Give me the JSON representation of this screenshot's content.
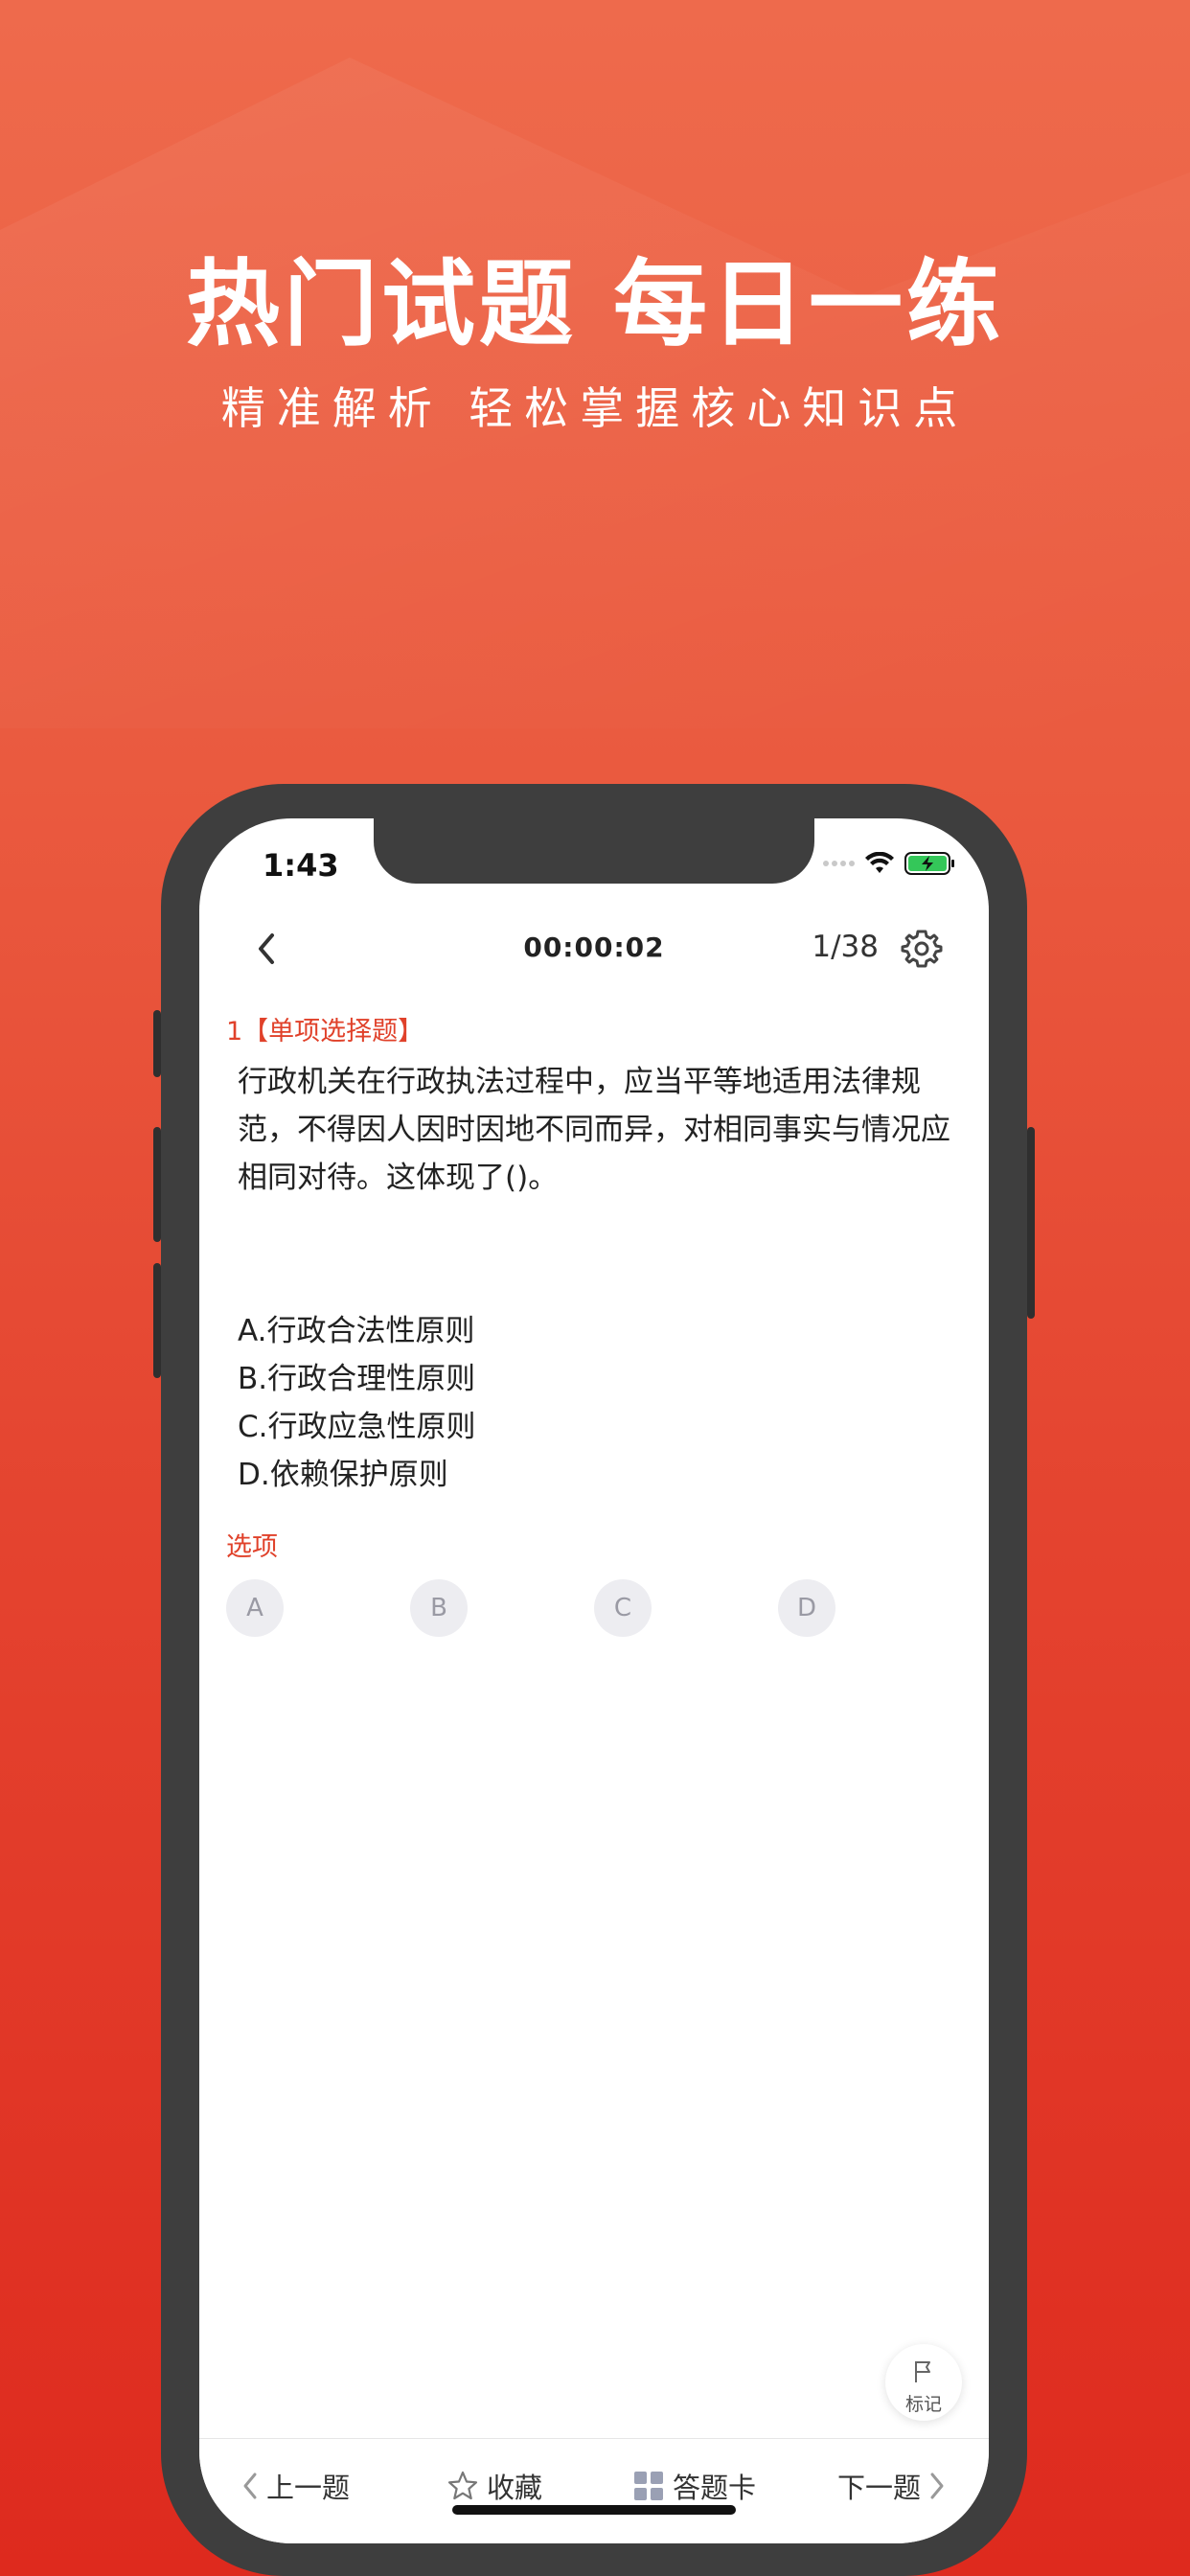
{
  "banner": {
    "headline": "热门试题 每日一练",
    "subline": "精准解析 轻松掌握核心知识点"
  },
  "status_bar": {
    "time": "1:43",
    "icons": [
      "signal-icon",
      "wifi-icon",
      "battery-charging-icon"
    ]
  },
  "nav": {
    "timer": "00:00:02",
    "counter": "1/38",
    "back_icon": "chevron-left-icon",
    "settings_icon": "gear-icon"
  },
  "question": {
    "type_label": "1【单项选择题】",
    "text": "行政机关在行政执法过程中，应当平等地适用法律规范，不得因人因时因地不同而异，对相同事实与情况应相同对待。这体现了()。",
    "options": [
      "A.行政合法性原则",
      "B.行政合理性原则",
      "C.行政应急性原则",
      "D.依赖保护原则"
    ]
  },
  "answer": {
    "label": "选项",
    "choices": [
      "A",
      "B",
      "C",
      "D"
    ]
  },
  "mark": {
    "label": "标记",
    "icon": "flag-icon"
  },
  "bottom_bar": {
    "prev": "上一题",
    "favorite": "收藏",
    "answer_card": "答题卡",
    "next": "下一题"
  },
  "colors": {
    "accent": "#e0412a",
    "background_top": "#ee6a4c",
    "background_bottom": "#de2a1e",
    "phone_frame": "#3e3e3e",
    "choice_bg": "#ededf1"
  }
}
